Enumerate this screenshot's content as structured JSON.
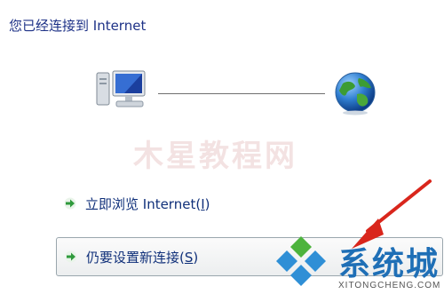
{
  "header": {
    "title": "您已经连接到 Internet"
  },
  "diagram": {
    "computer_icon": "computer-icon",
    "globe_icon": "internet-globe-icon"
  },
  "actions": {
    "browse_label": "立即浏览 Internet(",
    "browse_key": "I",
    "browse_close": ")",
    "new_label": "仍要设置新连接(",
    "new_key": "S",
    "new_close": ")",
    "arrow_icon": "green-arrow-icon"
  },
  "watermarks": {
    "center_text": "木星教程网",
    "logo_text": "系统城",
    "logo_url": "XITONGCHENG.COM"
  },
  "colors": {
    "title": "#1e3287",
    "link": "#10307a",
    "arrow_green": "#2f9a3c",
    "annotation_red": "#d9261c",
    "logo_blue": "#1f6fb6",
    "logo_green": "#4db33d"
  }
}
